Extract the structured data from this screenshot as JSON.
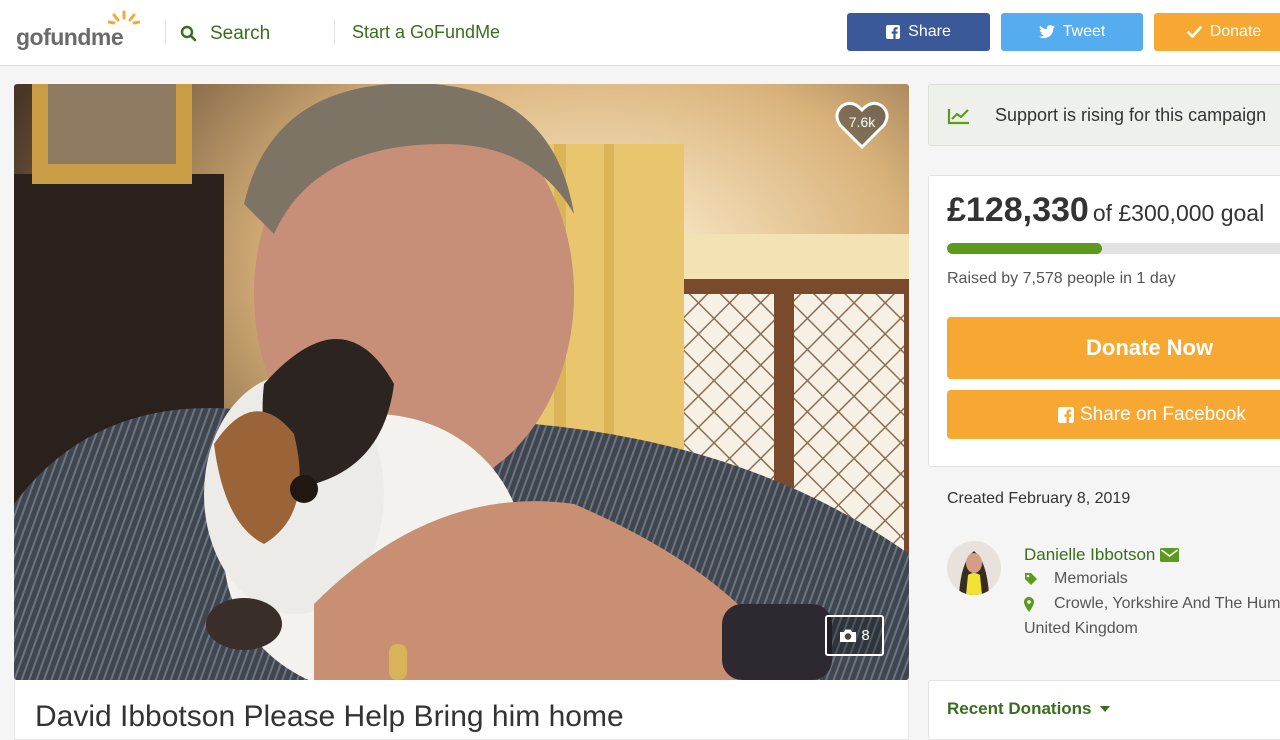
{
  "header": {
    "logo_text": "gofundme",
    "search_label": "Search",
    "start_label": "Start a GoFundMe",
    "share_label": "Share",
    "tweet_label": "Tweet",
    "donate_label": "Donate"
  },
  "hero": {
    "heart_count": "7.6k",
    "photo_count": "8"
  },
  "campaign": {
    "title": "David Ibbotson Please Help Bring him home"
  },
  "sidebar": {
    "support_text": "Support is rising for this campaign",
    "raised_amount": "£128,330",
    "raised_goal": "of £300,000 goal",
    "progress_fraction": 0.43,
    "raised_by": "Raised by 7,578 people in 1 day",
    "donate_now_label": "Donate Now",
    "share_facebook_label": "Share on Facebook",
    "created": "Created February 8, 2019",
    "organizer_name": "Danielle Ibbotson",
    "category": "Memorials",
    "location_line1": "Crowle, Yorkshire And The Humber",
    "location_line2": "United Kingdom",
    "recent_donations_label": "Recent Donations"
  },
  "colors": {
    "brand_green": "#3a6e1c",
    "progress_green": "#5b9a1c",
    "donate_orange": "#f7a833",
    "facebook_blue": "#3b5998",
    "twitter_blue": "#55acee"
  }
}
